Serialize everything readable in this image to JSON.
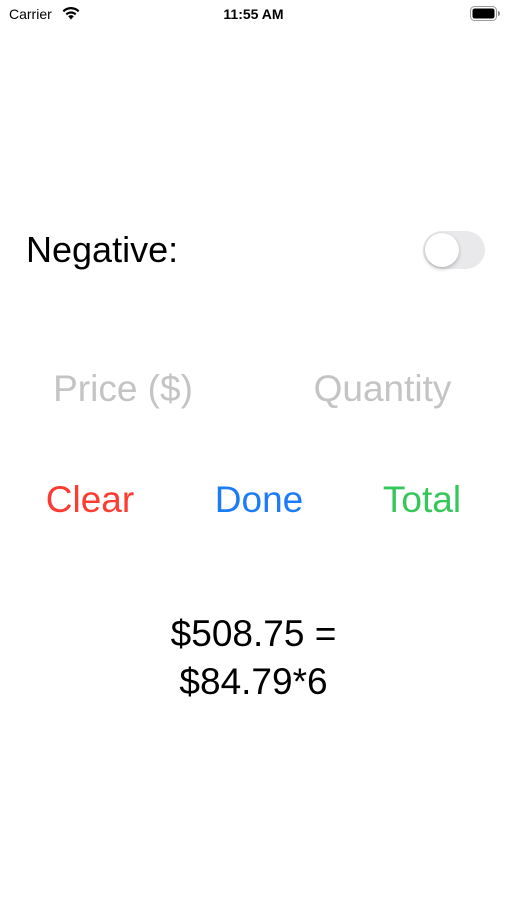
{
  "status_bar": {
    "carrier": "Carrier",
    "time": "11:55 AM",
    "wifi_icon": "wifi-icon",
    "battery_icon": "battery-full-icon"
  },
  "negative": {
    "label": "Negative:",
    "toggle_on": false
  },
  "inputs": {
    "price_placeholder": "Price ($)",
    "price_value": "",
    "quantity_placeholder": "Quantity",
    "quantity_value": ""
  },
  "buttons": {
    "clear_label": "Clear",
    "done_label": "Done",
    "total_label": "Total"
  },
  "result": {
    "line1": "$508.75 =",
    "line2": "$84.79*6"
  },
  "colors": {
    "clear": "#fe3b30",
    "done": "#1b7cf6",
    "total": "#35c759",
    "placeholder": "#c4c4c6",
    "toggle_off": "#e9e9eb"
  }
}
